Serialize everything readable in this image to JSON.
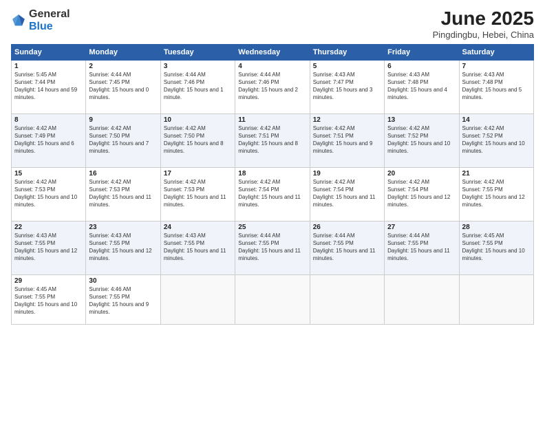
{
  "logo": {
    "general": "General",
    "blue": "Blue"
  },
  "title": "June 2025",
  "subtitle": "Pingdingbu, Hebei, China",
  "days_header": [
    "Sunday",
    "Monday",
    "Tuesday",
    "Wednesday",
    "Thursday",
    "Friday",
    "Saturday"
  ],
  "weeks": [
    [
      {
        "day": "1",
        "sunrise": "5:45 AM",
        "sunset": "7:44 PM",
        "daylight": "14 hours and 59 minutes."
      },
      {
        "day": "2",
        "sunrise": "4:44 AM",
        "sunset": "7:45 PM",
        "daylight": "15 hours and 0 minutes."
      },
      {
        "day": "3",
        "sunrise": "4:44 AM",
        "sunset": "7:46 PM",
        "daylight": "15 hours and 1 minute."
      },
      {
        "day": "4",
        "sunrise": "4:44 AM",
        "sunset": "7:46 PM",
        "daylight": "15 hours and 2 minutes."
      },
      {
        "day": "5",
        "sunrise": "4:43 AM",
        "sunset": "7:47 PM",
        "daylight": "15 hours and 3 minutes."
      },
      {
        "day": "6",
        "sunrise": "4:43 AM",
        "sunset": "7:48 PM",
        "daylight": "15 hours and 4 minutes."
      },
      {
        "day": "7",
        "sunrise": "4:43 AM",
        "sunset": "7:48 PM",
        "daylight": "15 hours and 5 minutes."
      }
    ],
    [
      {
        "day": "8",
        "sunrise": "4:42 AM",
        "sunset": "7:49 PM",
        "daylight": "15 hours and 6 minutes."
      },
      {
        "day": "9",
        "sunrise": "4:42 AM",
        "sunset": "7:50 PM",
        "daylight": "15 hours and 7 minutes."
      },
      {
        "day": "10",
        "sunrise": "4:42 AM",
        "sunset": "7:50 PM",
        "daylight": "15 hours and 8 minutes."
      },
      {
        "day": "11",
        "sunrise": "4:42 AM",
        "sunset": "7:51 PM",
        "daylight": "15 hours and 8 minutes."
      },
      {
        "day": "12",
        "sunrise": "4:42 AM",
        "sunset": "7:51 PM",
        "daylight": "15 hours and 9 minutes."
      },
      {
        "day": "13",
        "sunrise": "4:42 AM",
        "sunset": "7:52 PM",
        "daylight": "15 hours and 10 minutes."
      },
      {
        "day": "14",
        "sunrise": "4:42 AM",
        "sunset": "7:52 PM",
        "daylight": "15 hours and 10 minutes."
      }
    ],
    [
      {
        "day": "15",
        "sunrise": "4:42 AM",
        "sunset": "7:53 PM",
        "daylight": "15 hours and 10 minutes."
      },
      {
        "day": "16",
        "sunrise": "4:42 AM",
        "sunset": "7:53 PM",
        "daylight": "15 hours and 11 minutes."
      },
      {
        "day": "17",
        "sunrise": "4:42 AM",
        "sunset": "7:53 PM",
        "daylight": "15 hours and 11 minutes."
      },
      {
        "day": "18",
        "sunrise": "4:42 AM",
        "sunset": "7:54 PM",
        "daylight": "15 hours and 11 minutes."
      },
      {
        "day": "19",
        "sunrise": "4:42 AM",
        "sunset": "7:54 PM",
        "daylight": "15 hours and 11 minutes."
      },
      {
        "day": "20",
        "sunrise": "4:42 AM",
        "sunset": "7:54 PM",
        "daylight": "15 hours and 12 minutes."
      },
      {
        "day": "21",
        "sunrise": "4:42 AM",
        "sunset": "7:55 PM",
        "daylight": "15 hours and 12 minutes."
      }
    ],
    [
      {
        "day": "22",
        "sunrise": "4:43 AM",
        "sunset": "7:55 PM",
        "daylight": "15 hours and 12 minutes."
      },
      {
        "day": "23",
        "sunrise": "4:43 AM",
        "sunset": "7:55 PM",
        "daylight": "15 hours and 12 minutes."
      },
      {
        "day": "24",
        "sunrise": "4:43 AM",
        "sunset": "7:55 PM",
        "daylight": "15 hours and 11 minutes."
      },
      {
        "day": "25",
        "sunrise": "4:44 AM",
        "sunset": "7:55 PM",
        "daylight": "15 hours and 11 minutes."
      },
      {
        "day": "26",
        "sunrise": "4:44 AM",
        "sunset": "7:55 PM",
        "daylight": "15 hours and 11 minutes."
      },
      {
        "day": "27",
        "sunrise": "4:44 AM",
        "sunset": "7:55 PM",
        "daylight": "15 hours and 11 minutes."
      },
      {
        "day": "28",
        "sunrise": "4:45 AM",
        "sunset": "7:55 PM",
        "daylight": "15 hours and 10 minutes."
      }
    ],
    [
      {
        "day": "29",
        "sunrise": "4:45 AM",
        "sunset": "7:55 PM",
        "daylight": "15 hours and 10 minutes."
      },
      {
        "day": "30",
        "sunrise": "4:46 AM",
        "sunset": "7:55 PM",
        "daylight": "15 hours and 9 minutes."
      },
      null,
      null,
      null,
      null,
      null
    ]
  ],
  "labels": {
    "sunrise": "Sunrise:",
    "sunset": "Sunset:",
    "daylight": "Daylight:"
  }
}
